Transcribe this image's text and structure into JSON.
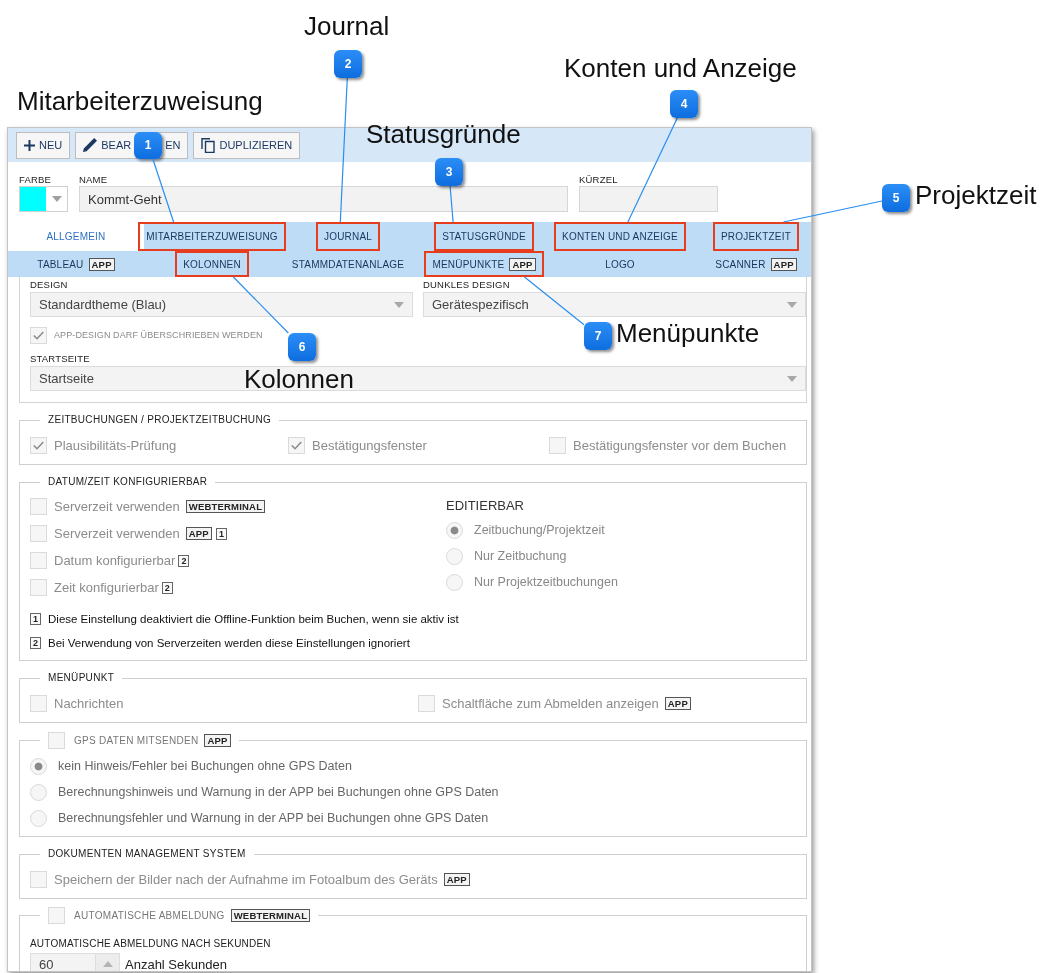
{
  "toolbar": {
    "buttons": [
      {
        "kind": "add",
        "label": "NEU"
      },
      {
        "kind": "edit",
        "label": "BEAR",
        "label_end": "EN"
      },
      {
        "kind": "duplicate",
        "label": "DUPLIZIEREN"
      }
    ]
  },
  "fields": {
    "color": {
      "label": "FARBE",
      "color": "#00ffff"
    },
    "name": {
      "label": "NAME",
      "value": "Kommt-Geht"
    },
    "abbreviation": {
      "label": "KÜRZEL"
    }
  },
  "tab_rows": [
    [
      {
        "label": "ALLGEMEIN",
        "selected": true,
        "highlighted": false
      },
      {
        "label": "MITARBEITERZUWEISUNG",
        "selected": false,
        "highlighted": true
      },
      {
        "label": "JOURNAL",
        "selected": false,
        "highlighted": true
      },
      {
        "label": "STATUSGRÜNDE",
        "selected": false,
        "highlighted": true
      },
      {
        "label": "KONTEN UND ANZEIGE",
        "selected": false,
        "highlighted": true
      },
      {
        "label": "PROJEKTZEIT",
        "selected": false,
        "highlighted": true
      }
    ],
    [
      {
        "label": "TABLEAU",
        "tag": "APP",
        "selected": false,
        "highlighted": false
      },
      {
        "label": "KOLONNEN",
        "selected": false,
        "highlighted": true
      },
      {
        "label": "STAMMDATENANLAGE",
        "selected": false,
        "highlighted": false
      },
      {
        "label": "MENÜPUNKTE",
        "tag": "APP",
        "selected": false,
        "highlighted": true
      },
      {
        "label": "LOGO",
        "selected": false,
        "highlighted": false
      },
      {
        "label": "SCANNER",
        "tag": "APP",
        "selected": false,
        "highlighted": false
      }
    ]
  ],
  "appearance": {
    "design": {
      "label": "DESIGN",
      "value": "Standardtheme (Blau)"
    },
    "dark_design": {
      "label": "DUNKLES DESIGN",
      "value": "Gerätespezifisch"
    },
    "override": {
      "label": "APP-DESIGN DARF ÜBERSCHRIEBEN WERDEN",
      "checked": true,
      "disabled": true
    },
    "start_page": {
      "label": "STARTSEITE",
      "value": "Startseite"
    }
  },
  "time_bookings": {
    "title": "ZEITBUCHUNGEN / PROJEKTZEITBUCHUNG",
    "options": [
      {
        "label": "Plausibilitäts-Prüfung",
        "checked": true,
        "disabled": true
      },
      {
        "label": "Bestätigungsfenster",
        "checked": true,
        "disabled": true
      },
      {
        "label": "Bestätigungsfenster vor dem Buchen",
        "checked": false,
        "disabled": true
      }
    ]
  },
  "date_time": {
    "title": "DATUM/ZEIT KONFIGURIERBAR",
    "options": [
      {
        "label": "Serverzeit verwenden",
        "tag": "WEBTERMINAL",
        "checked": false,
        "disabled": true
      },
      {
        "label": "Serverzeit verwenden",
        "tag": "APP",
        "note": "1",
        "checked": false,
        "disabled": true
      },
      {
        "label": "Datum konfigurierbar",
        "note": "2",
        "checked": false,
        "disabled": true
      },
      {
        "label": "Zeit konfigurierbar",
        "note": "2",
        "checked": false,
        "disabled": true
      }
    ],
    "editable": {
      "title": "EDITIERBAR",
      "options": [
        {
          "label": "Zeitbuchung/Projektzeit",
          "selected": true,
          "disabled": true
        },
        {
          "label": "Nur Zeitbuchung",
          "selected": false,
          "disabled": true
        },
        {
          "label": "Nur Projektzeitbuchungen",
          "selected": false,
          "disabled": true
        }
      ]
    },
    "footnotes": [
      {
        "note": "1",
        "text": "Diese Einstellung deaktiviert die Offline-Funktion beim Buchen, wenn sie aktiv ist"
      },
      {
        "note": "2",
        "text": "Bei Verwendung von Serverzeiten werden diese Einstellungen ignoriert"
      }
    ]
  },
  "menu_item": {
    "title": "MENÜPUNKT",
    "options": [
      {
        "label": "Nachrichten",
        "checked": false,
        "disabled": true
      },
      {
        "label": "Schaltfläche zum Abmelden anzeigen",
        "tag": "APP",
        "checked": false,
        "disabled": true
      }
    ]
  },
  "gps": {
    "title": "GPS DATEN MITSENDEN",
    "tag": "APP",
    "checked": false,
    "disabled": true,
    "options": [
      {
        "label": "kein Hinweis/Fehler bei Buchungen ohne GPS Daten",
        "selected": true,
        "disabled": true
      },
      {
        "label": "Berechnungshinweis und Warnung in der APP bei Buchungen ohne GPS Daten",
        "selected": false,
        "disabled": true
      },
      {
        "label": "Berechnungsfehler und Warnung in der APP bei Buchungen ohne GPS Daten",
        "selected": false,
        "disabled": true
      }
    ]
  },
  "document_management": {
    "title": "DOKUMENTEN MANAGEMENT SYSTEM",
    "options": [
      {
        "label": "Speichern der Bilder nach der Aufnahme im Fotoalbum des Geräts",
        "tag": "APP",
        "checked": false,
        "disabled": true
      }
    ]
  },
  "auto_logout": {
    "title": "AUTOMATISCHE ABMELDUNG",
    "tag": "WEBTERMINAL",
    "checked": false,
    "disabled": true,
    "seconds": {
      "label": "AUTOMATISCHE ABMELDUNG NACH SEKUNDEN",
      "value": "60",
      "unit": "Anzahl Sekunden"
    }
  },
  "callouts": [
    {
      "number": "1",
      "label": "Mitarbeiterzuweisung"
    },
    {
      "number": "2",
      "label": "Journal"
    },
    {
      "number": "3",
      "label": "Statusgründe"
    },
    {
      "number": "4",
      "label": "Konten und Anzeige"
    },
    {
      "number": "5",
      "label": "Projektzeit"
    },
    {
      "number": "6",
      "label": "Kolonnen"
    },
    {
      "number": "7",
      "label": "Menüpunkte"
    }
  ]
}
